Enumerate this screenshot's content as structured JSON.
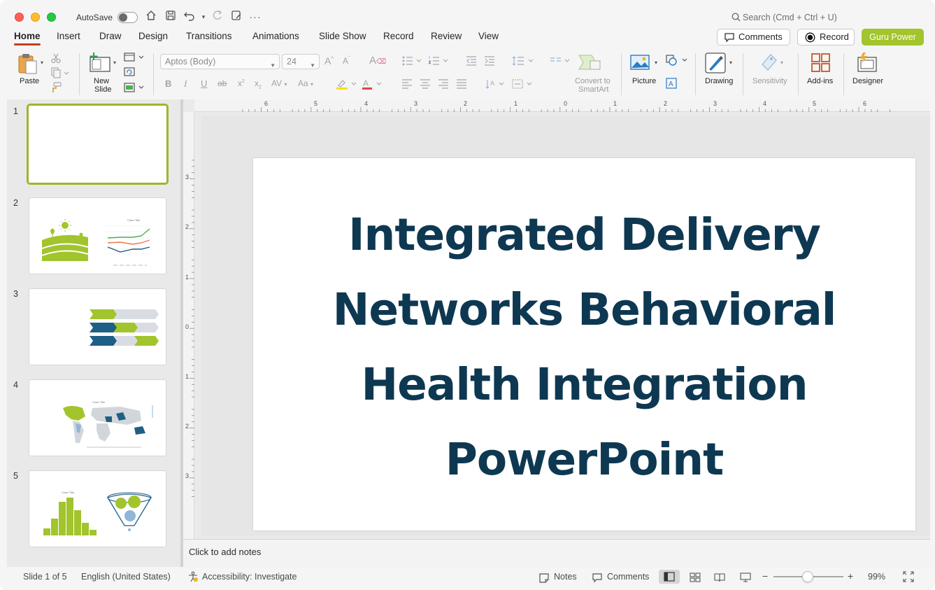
{
  "titlebar": {
    "autosave_label": "AutoSave",
    "search_placeholder": "Search (Cmd + Ctrl + U)"
  },
  "menu": {
    "tabs": [
      "Home",
      "Insert",
      "Draw",
      "Design",
      "Transitions",
      "Animations",
      "Slide Show",
      "Record",
      "Review",
      "View"
    ],
    "active_tab": "Home",
    "comments_label": "Comments",
    "record_label": "Record",
    "addon_label": "Guru Power"
  },
  "ribbon": {
    "paste_label": "Paste",
    "new_slide_label": "New\nSlide",
    "new_slide_line1": "New",
    "new_slide_line2": "Slide",
    "font_name": "Aptos (Body)",
    "font_size": "24",
    "convert_line1": "Convert to",
    "convert_line2": "SmartArt",
    "picture_label": "Picture",
    "drawing_label": "Drawing",
    "sensitivity_label": "Sensitivity",
    "addins_label": "Add-ins",
    "designer_label": "Designer"
  },
  "thumbnails": [
    {
      "number": "1",
      "selected": true
    },
    {
      "number": "2",
      "selected": false
    },
    {
      "number": "3",
      "selected": false
    },
    {
      "number": "4",
      "selected": false
    },
    {
      "number": "5",
      "selected": false
    }
  ],
  "ruler": {
    "h_labels": [
      "6",
      "5",
      "4",
      "3",
      "2",
      "1",
      "0",
      "1",
      "2",
      "3",
      "4",
      "5",
      "6"
    ],
    "v_labels": [
      "3",
      "2",
      "1",
      "0",
      "1",
      "2",
      "3"
    ]
  },
  "slide": {
    "title": "Integrated Delivery Networks Behavioral Health Integration PowerPoint"
  },
  "notes": {
    "placeholder": "Click to add notes"
  },
  "status": {
    "slide_indicator": "Slide 1 of 5",
    "language": "English (United States)",
    "accessibility": "Accessibility: Investigate",
    "notes_label": "Notes",
    "comments_label": "Comments",
    "zoom": "99%"
  },
  "colors": {
    "accent_green": "#a2c42c",
    "title_navy": "#0e3852",
    "thumb_blue": "#1f5f86"
  }
}
